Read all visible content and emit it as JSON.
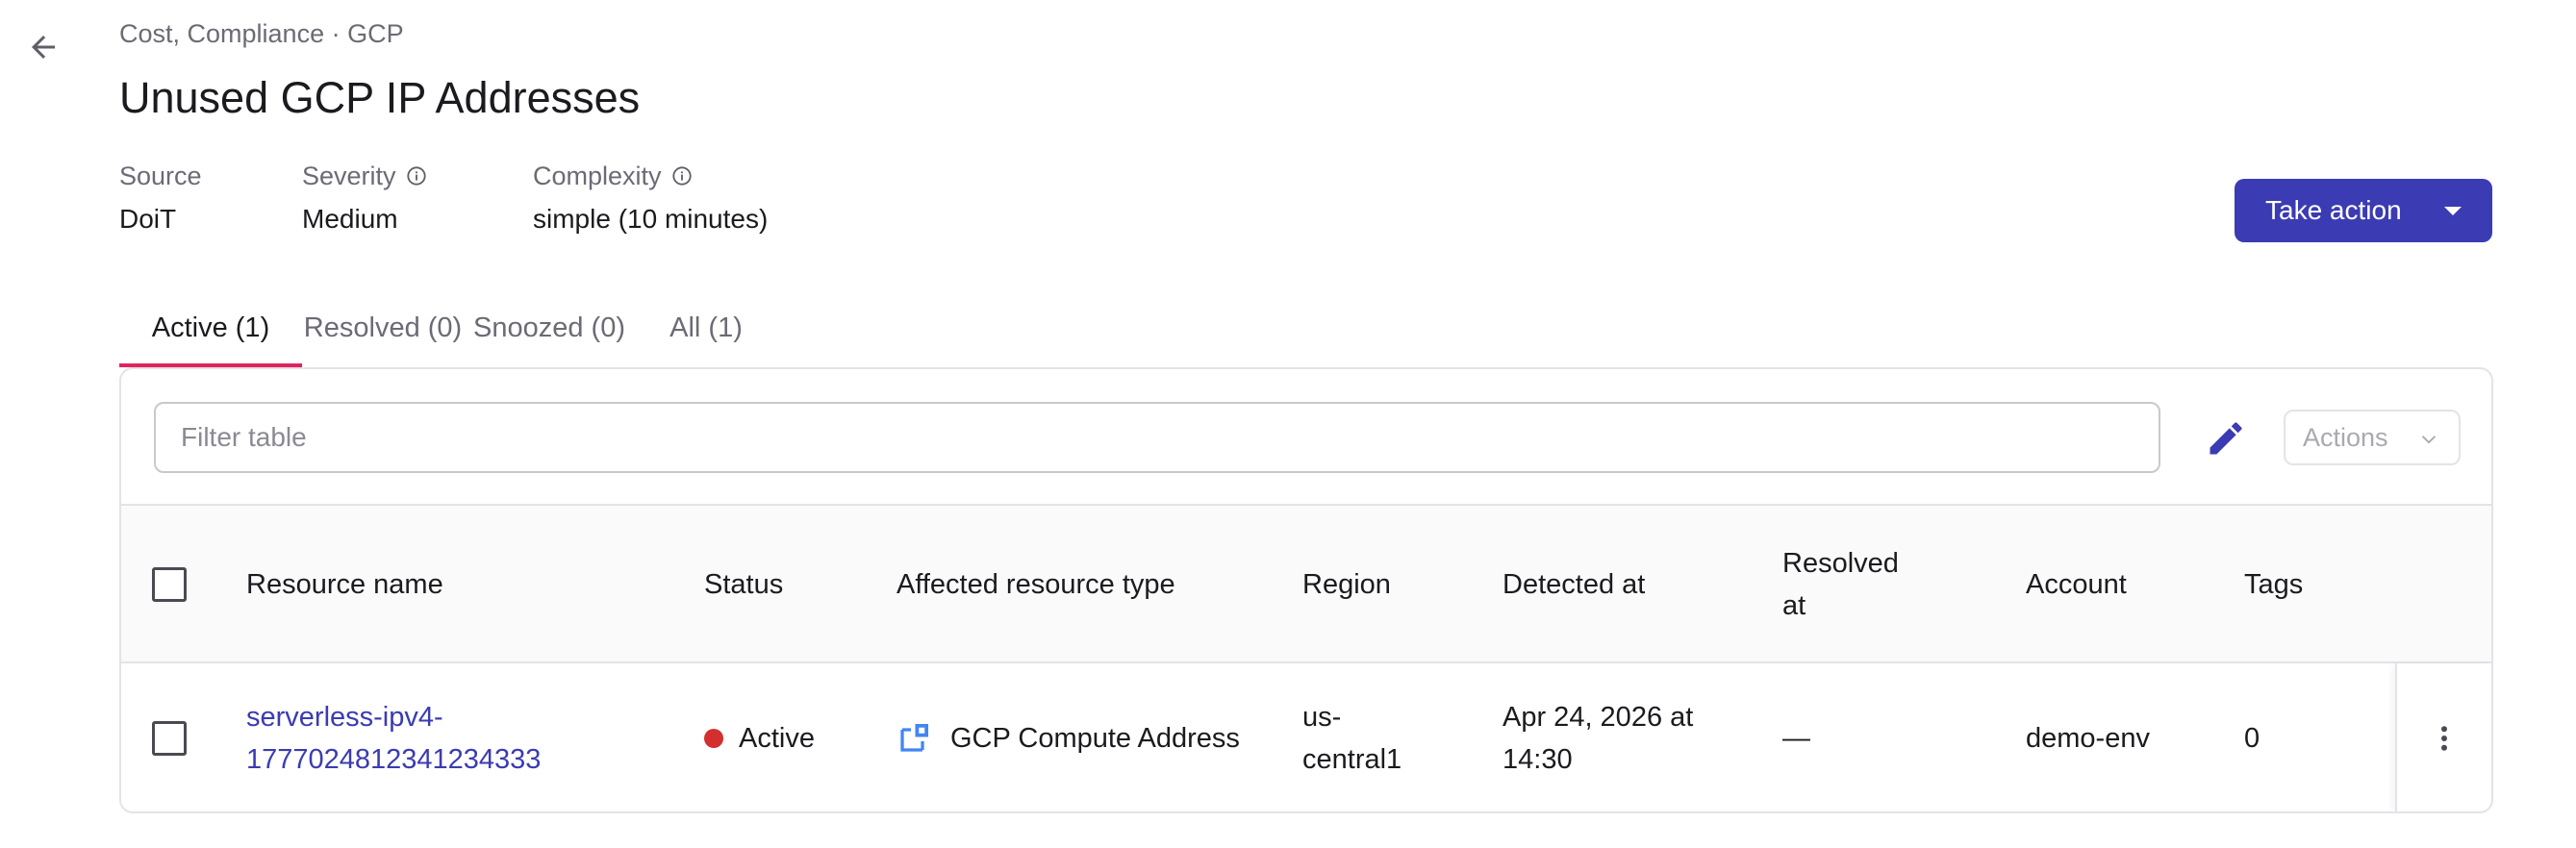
{
  "header": {
    "breadcrumb": "Cost, Compliance · GCP",
    "title": "Unused GCP IP Addresses"
  },
  "meta": {
    "source_label": "Source",
    "source_value": "DoiT",
    "severity_label": "Severity",
    "severity_value": "Medium",
    "complexity_label": "Complexity",
    "complexity_value": "simple (10 minutes)"
  },
  "take_action_label": "Take action",
  "tabs": [
    {
      "label": "Active (1)",
      "active": true
    },
    {
      "label": "Resolved (0)",
      "active": false
    },
    {
      "label": "Snoozed (0)",
      "active": false
    },
    {
      "label": "All (1)",
      "active": false
    }
  ],
  "toolbar": {
    "filter_placeholder": "Filter table",
    "actions_label": "Actions"
  },
  "table": {
    "columns": {
      "resource_name": "Resource name",
      "status": "Status",
      "affected_type": "Affected resource type",
      "region": "Region",
      "detected_at": "Detected at",
      "resolved_at_1": "Resolved",
      "resolved_at_2": "at",
      "account": "Account",
      "tags": "Tags"
    },
    "rows": [
      {
        "resource_name_1": "serverless-ipv4-",
        "resource_name_2": "1777024812341234333",
        "status": "Active",
        "affected_type": "GCP Compute Address",
        "region_1": "us-",
        "region_2": "central1",
        "detected_at_1": "Apr 24, 2026 at",
        "detected_at_2": "14:30",
        "resolved_at": "—",
        "account": "demo-env",
        "tags": "0"
      }
    ]
  },
  "colors": {
    "primary": "#3b3bb3",
    "tab_indicator": "#e0245e",
    "status_active": "#d32f2f",
    "gcp_icon": "#4285f4"
  },
  "icons": [
    "arrow-left-icon",
    "info-icon",
    "caret-down-icon",
    "pencil-icon",
    "chevron-down-icon",
    "gcp-compute-address-icon",
    "more-vertical-icon"
  ]
}
